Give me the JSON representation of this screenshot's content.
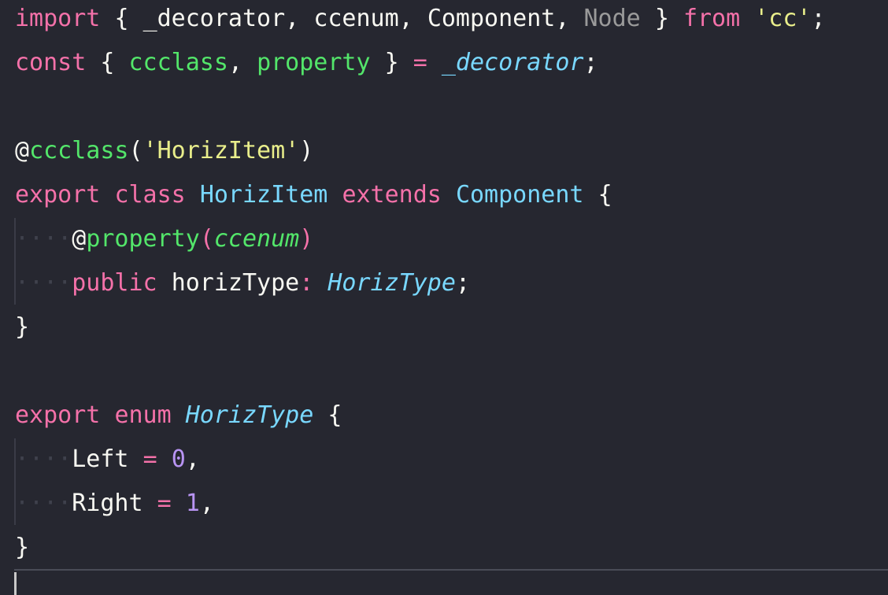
{
  "editor": {
    "theme_colors": {
      "background": "#262730",
      "keyword": "#f471a9",
      "string": "#e9ee8b",
      "function": "#53e66a",
      "type": "#79d8ff",
      "number": "#b894f3"
    },
    "lines": [
      {
        "tokens": [
          {
            "text": "import",
            "kind": "keyword"
          },
          {
            "text": " ",
            "kind": "ws"
          },
          {
            "text": "{",
            "kind": "plain"
          },
          {
            "text": " ",
            "kind": "ws"
          },
          {
            "text": "_decorator,",
            "kind": "plain"
          },
          {
            "text": " ",
            "kind": "ws"
          },
          {
            "text": "ccenum,",
            "kind": "plain"
          },
          {
            "text": " ",
            "kind": "ws"
          },
          {
            "text": "Component,",
            "kind": "plain"
          },
          {
            "text": " ",
            "kind": "ws"
          },
          {
            "text": "Node",
            "kind": "dim"
          },
          {
            "text": " ",
            "kind": "ws"
          },
          {
            "text": "}",
            "kind": "plain"
          },
          {
            "text": " ",
            "kind": "ws"
          },
          {
            "text": "from",
            "kind": "keyword"
          },
          {
            "text": " ",
            "kind": "ws"
          },
          {
            "text": "'cc'",
            "kind": "string"
          },
          {
            "text": ";",
            "kind": "plain"
          }
        ]
      },
      {
        "tokens": [
          {
            "text": "const",
            "kind": "keyword"
          },
          {
            "text": " ",
            "kind": "ws"
          },
          {
            "text": "{",
            "kind": "plain"
          },
          {
            "text": " ",
            "kind": "ws"
          },
          {
            "text": "ccclass",
            "kind": "green"
          },
          {
            "text": ",",
            "kind": "plain"
          },
          {
            "text": " ",
            "kind": "ws"
          },
          {
            "text": "property",
            "kind": "green"
          },
          {
            "text": " ",
            "kind": "ws"
          },
          {
            "text": "}",
            "kind": "plain"
          },
          {
            "text": " ",
            "kind": "ws"
          },
          {
            "text": "=",
            "kind": "keyword"
          },
          {
            "text": " ",
            "kind": "ws"
          },
          {
            "text": "_decorator",
            "kind": "italic-cyan"
          },
          {
            "text": ";",
            "kind": "plain"
          }
        ]
      },
      {
        "tokens": []
      },
      {
        "tokens": [
          {
            "text": "@",
            "kind": "plain"
          },
          {
            "text": "ccclass",
            "kind": "green"
          },
          {
            "text": "(",
            "kind": "plain"
          },
          {
            "text": "'HorizItem'",
            "kind": "string"
          },
          {
            "text": ")",
            "kind": "plain"
          }
        ]
      },
      {
        "tokens": [
          {
            "text": "export",
            "kind": "keyword"
          },
          {
            "text": " ",
            "kind": "ws"
          },
          {
            "text": "class",
            "kind": "keyword"
          },
          {
            "text": " ",
            "kind": "ws"
          },
          {
            "text": "HorizItem",
            "kind": "type"
          },
          {
            "text": " ",
            "kind": "ws"
          },
          {
            "text": "extends",
            "kind": "keyword"
          },
          {
            "text": " ",
            "kind": "ws"
          },
          {
            "text": "Component",
            "kind": "type"
          },
          {
            "text": " ",
            "kind": "ws"
          },
          {
            "text": "{",
            "kind": "plain"
          }
        ]
      },
      {
        "tokens": [
          {
            "text": "····",
            "kind": "ws"
          },
          {
            "text": "@",
            "kind": "plain"
          },
          {
            "text": "property",
            "kind": "green"
          },
          {
            "text": "(",
            "kind": "keyword"
          },
          {
            "text": "ccenum",
            "kind": "italic-green"
          },
          {
            "text": ")",
            "kind": "keyword"
          }
        ]
      },
      {
        "tokens": [
          {
            "text": "····",
            "kind": "ws"
          },
          {
            "text": "public",
            "kind": "keyword"
          },
          {
            "text": " ",
            "kind": "ws"
          },
          {
            "text": "horizType",
            "kind": "plain"
          },
          {
            "text": ":",
            "kind": "keyword"
          },
          {
            "text": " ",
            "kind": "ws"
          },
          {
            "text": "HorizType",
            "kind": "italic-cyan"
          },
          {
            "text": ";",
            "kind": "plain"
          }
        ]
      },
      {
        "tokens": [
          {
            "text": "}",
            "kind": "plain"
          }
        ]
      },
      {
        "tokens": []
      },
      {
        "tokens": [
          {
            "text": "export",
            "kind": "keyword"
          },
          {
            "text": " ",
            "kind": "ws"
          },
          {
            "text": "enum",
            "kind": "keyword"
          },
          {
            "text": " ",
            "kind": "ws"
          },
          {
            "text": "HorizType",
            "kind": "italic-cyan"
          },
          {
            "text": " ",
            "kind": "ws"
          },
          {
            "text": "{",
            "kind": "plain"
          }
        ]
      },
      {
        "tokens": [
          {
            "text": "····",
            "kind": "ws"
          },
          {
            "text": "Left",
            "kind": "plain"
          },
          {
            "text": " ",
            "kind": "ws"
          },
          {
            "text": "=",
            "kind": "keyword"
          },
          {
            "text": " ",
            "kind": "ws"
          },
          {
            "text": "0",
            "kind": "number"
          },
          {
            "text": ",",
            "kind": "plain"
          }
        ]
      },
      {
        "tokens": [
          {
            "text": "····",
            "kind": "ws"
          },
          {
            "text": "Right",
            "kind": "plain"
          },
          {
            "text": " ",
            "kind": "ws"
          },
          {
            "text": "=",
            "kind": "keyword"
          },
          {
            "text": " ",
            "kind": "ws"
          },
          {
            "text": "1",
            "kind": "number"
          },
          {
            "text": ",",
            "kind": "plain"
          }
        ]
      },
      {
        "tokens": [
          {
            "text": "}",
            "kind": "plain"
          }
        ]
      }
    ]
  }
}
